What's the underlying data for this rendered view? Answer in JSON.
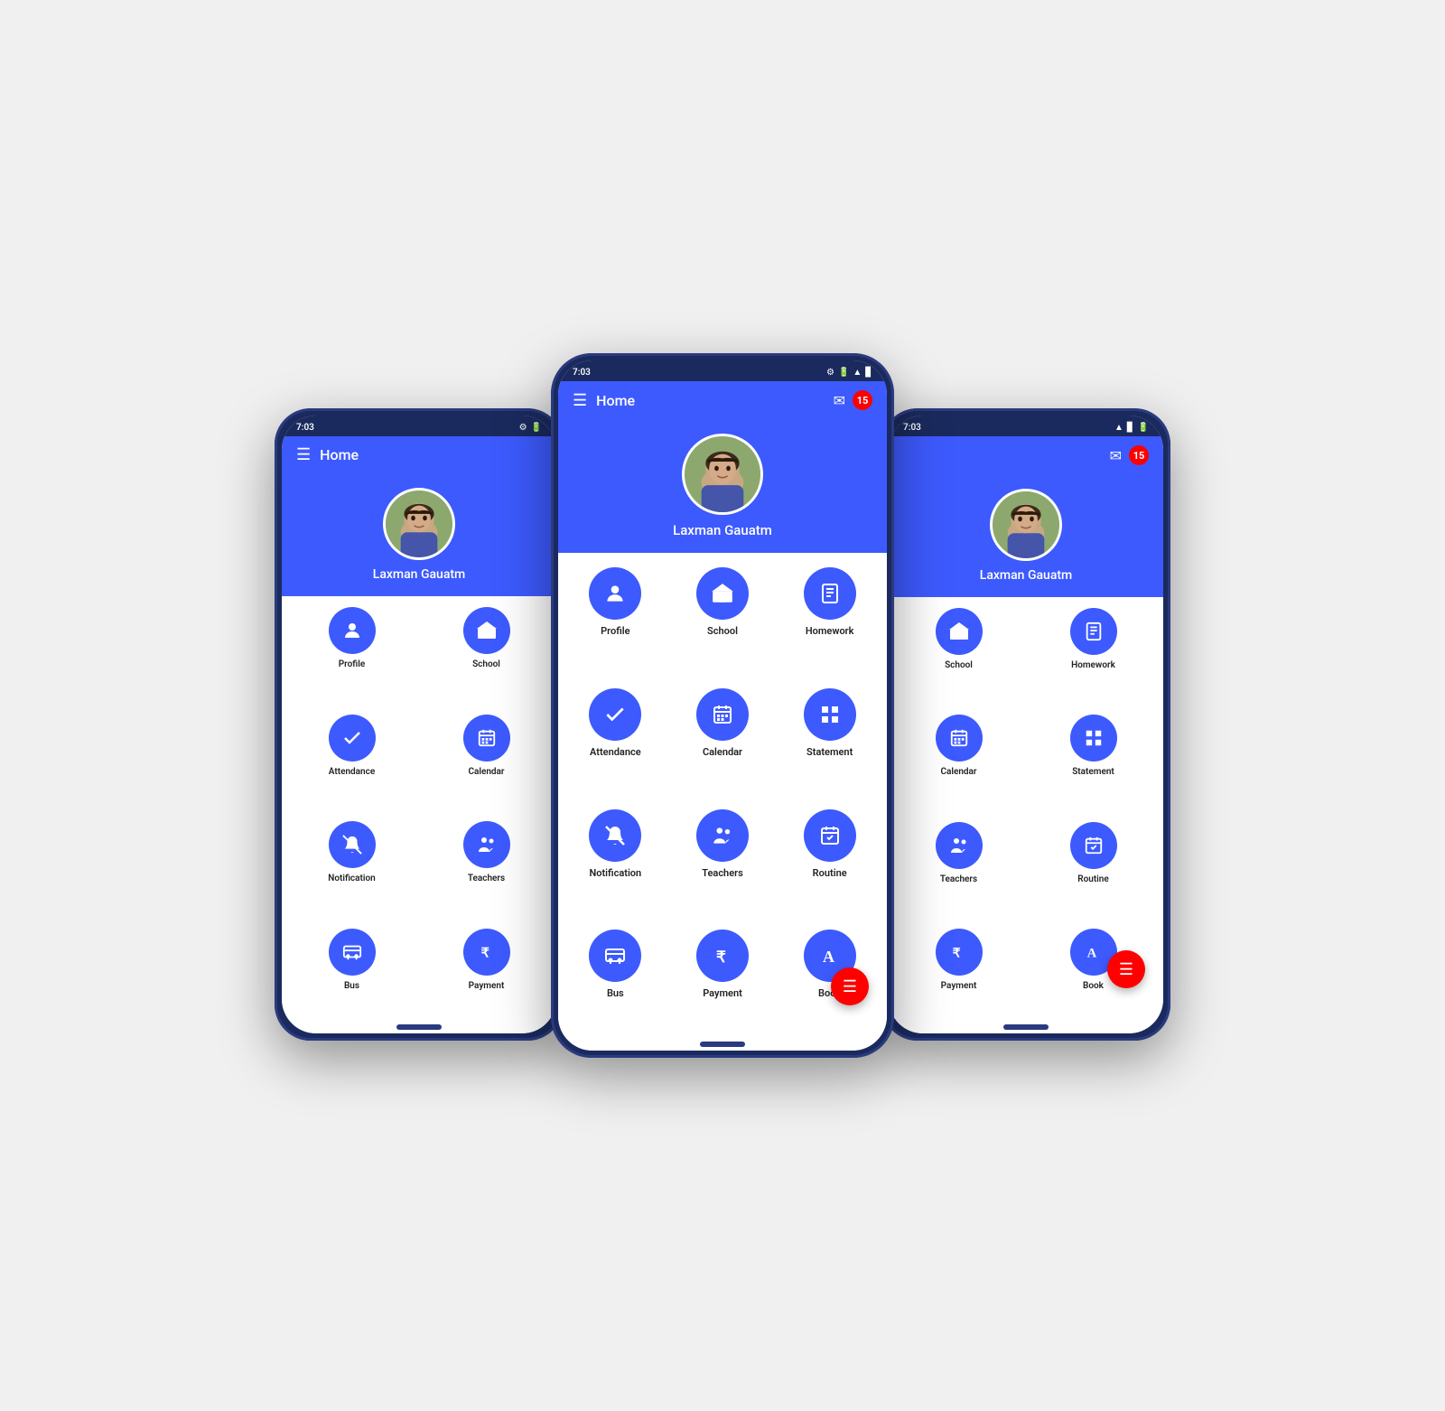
{
  "app": {
    "title": "Home",
    "time": "7:03",
    "notif_count": "15",
    "user_name": "Laxman Gauatm"
  },
  "menu_items_center": [
    {
      "id": "profile",
      "label": "Profile",
      "icon": "👤"
    },
    {
      "id": "school",
      "label": "School",
      "icon": "🏛"
    },
    {
      "id": "homework",
      "label": "Homework",
      "icon": "📋"
    },
    {
      "id": "attendance",
      "label": "Attendance",
      "icon": "✅"
    },
    {
      "id": "calendar",
      "label": "Calendar",
      "icon": "📅"
    },
    {
      "id": "statement",
      "label": "Statement",
      "icon": "📊"
    },
    {
      "id": "notification",
      "label": "Notification",
      "icon": "🔔"
    },
    {
      "id": "teachers",
      "label": "Teachers",
      "icon": "👥"
    },
    {
      "id": "routine",
      "label": "Routine",
      "icon": "📆"
    },
    {
      "id": "bus",
      "label": "Bus",
      "icon": "🚌"
    },
    {
      "id": "payment",
      "label": "Payment",
      "icon": "₹"
    },
    {
      "id": "book",
      "label": "Book",
      "icon": "🅰"
    }
  ],
  "menu_items_left": [
    {
      "id": "profile",
      "label": "Profile",
      "icon": "👤"
    },
    {
      "id": "school",
      "label": "School",
      "icon": "🏛"
    },
    {
      "id": "attendance",
      "label": "Attendance",
      "icon": "✅"
    },
    {
      "id": "calendar",
      "label": "Calendar",
      "icon": "📅"
    },
    {
      "id": "notification",
      "label": "Notification",
      "icon": "🔔"
    },
    {
      "id": "teachers",
      "label": "Teachers",
      "icon": "👥"
    },
    {
      "id": "bus",
      "label": "Bus",
      "icon": "🚌"
    },
    {
      "id": "payment",
      "label": "Payment",
      "icon": "₹"
    }
  ],
  "menu_items_right": [
    {
      "id": "school",
      "label": "School",
      "icon": "🏛"
    },
    {
      "id": "homework",
      "label": "Homework",
      "icon": "📋"
    },
    {
      "id": "calendar",
      "label": "Calendar",
      "icon": "📅"
    },
    {
      "id": "statement",
      "label": "Statement",
      "icon": "📊"
    },
    {
      "id": "teachers",
      "label": "Teachers",
      "icon": "👥"
    },
    {
      "id": "routine",
      "label": "Routine",
      "icon": "📆"
    },
    {
      "id": "payment",
      "label": "Payment",
      "icon": "₹"
    },
    {
      "id": "book",
      "label": "Book",
      "icon": "🅰"
    }
  ],
  "icons": {
    "profile": "person",
    "school": "bank",
    "homework": "book-open",
    "attendance": "checkmark",
    "calendar": "calendar",
    "statement": "grid",
    "notification": "bell-off",
    "teachers": "people",
    "routine": "calendar-check",
    "bus": "bus",
    "payment": "rupee",
    "book": "font-a",
    "hamburger": "menu",
    "mail": "mail",
    "badge": "15"
  }
}
